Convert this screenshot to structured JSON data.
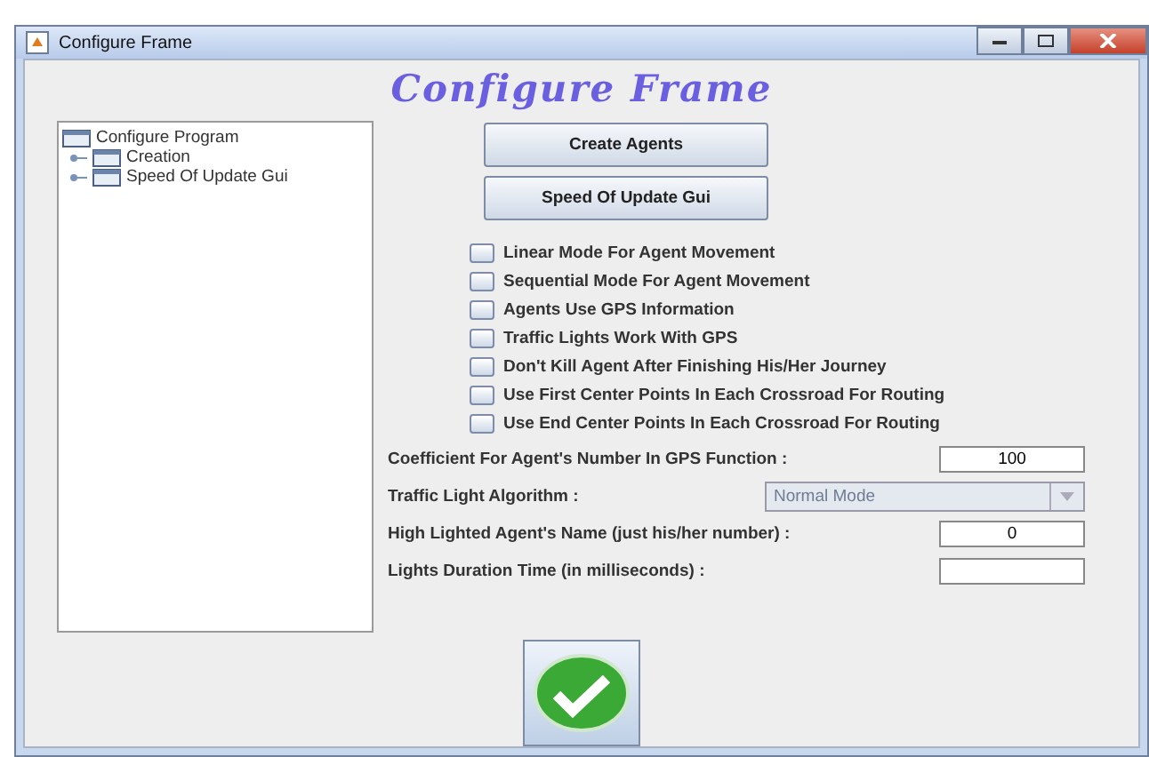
{
  "window": {
    "title": "Configure Frame"
  },
  "heading": "Configure Frame",
  "tree": {
    "label": "Configure Program",
    "children": [
      {
        "label": "Creation"
      },
      {
        "label": "Speed Of Update Gui"
      }
    ]
  },
  "buttons": [
    "Create Agents",
    "Speed Of Update Gui"
  ],
  "options": [
    {
      "label": "Linear Mode For Agent Movement",
      "checked": false
    },
    {
      "label": "Sequential Mode For Agent Movement",
      "checked": false
    },
    {
      "label": "Agents Use GPS Information",
      "checked": false
    },
    {
      "label": "Traffic Lights Work With GPS",
      "checked": false
    },
    {
      "label": "Don't Kill Agent After Finishing His/Her Journey",
      "checked": false
    },
    {
      "label": "Use First Center Points In Each Crossroad For Routing",
      "checked": false
    },
    {
      "label": "Use End Center Points In Each Crossroad For Routing",
      "checked": false
    }
  ],
  "fields": [
    {
      "kind": "text",
      "label": "Coefficient For Agent's Number In GPS Function :",
      "value": "100"
    },
    {
      "kind": "dropdown",
      "label": "Traffic Light Algorithm :",
      "value": "Normal Mode",
      "disabled": true
    },
    {
      "kind": "text",
      "label": "High Lighted Agent's Name (just his/her number) :",
      "value": "0"
    },
    {
      "kind": "text",
      "label": "Lights Duration Time (in milliseconds) :"
    }
  ]
}
